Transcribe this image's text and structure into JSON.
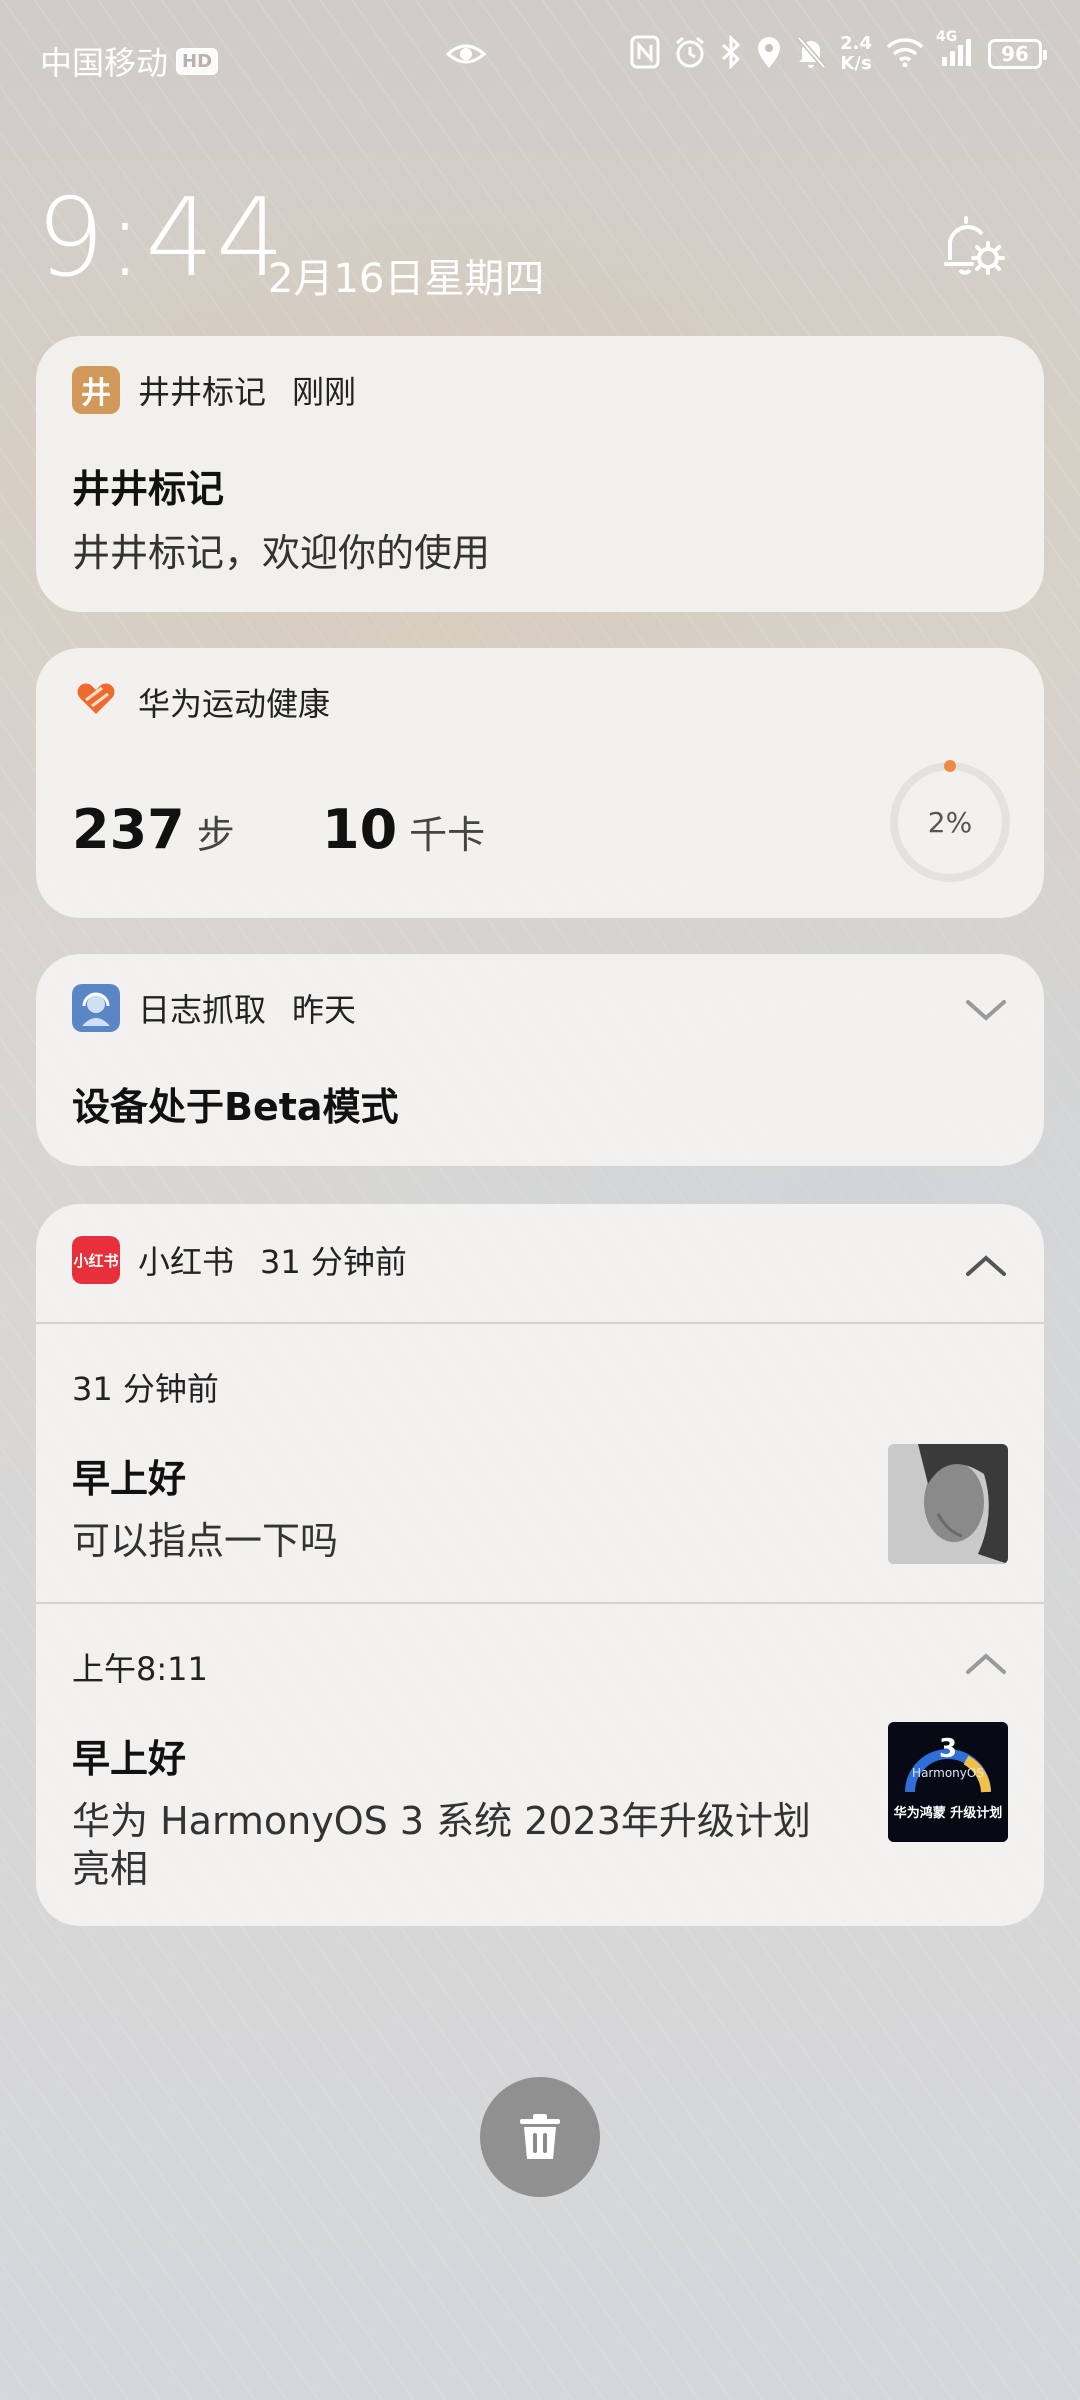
{
  "status_bar": {
    "carrier": "中国移动",
    "hd_badge": "HD",
    "net_speed_value": "2.4",
    "net_speed_unit": "K/s",
    "signal_label": "4G",
    "battery": "96",
    "icons": [
      "eye-icon",
      "nfc-icon",
      "alarm-icon",
      "bluetooth-icon",
      "location-icon",
      "mute-bell-icon",
      "wifi-icon",
      "cellular-signal-icon",
      "battery-icon"
    ]
  },
  "lockscreen": {
    "time": "9:44",
    "date": "2月16日星期四",
    "notification_settings_icon": "bell-settings-icon"
  },
  "notifications": [
    {
      "app_name": "井井标记",
      "app_icon_glyph": "井",
      "app_color": "#d29a5a",
      "time": "刚刚",
      "title": "井井标记",
      "text": "井井标记，欢迎你的使用"
    },
    {
      "app_name": "华为运动健康",
      "app_color": "#ef6a2c",
      "steps_value": "237",
      "steps_unit": "步",
      "calories_value": "10",
      "calories_unit": "千卡",
      "progress_label": "2%",
      "progress_fraction": 0.02
    },
    {
      "app_name": "日志抓取",
      "app_color": "#5a86c5",
      "time": "昨天",
      "title": "设备处于Beta模式"
    },
    {
      "app_name": "小红书",
      "app_icon_text": "小红书",
      "app_color": "#e8303c",
      "time": "31 分钟前",
      "items": [
        {
          "time": "31 分钟前",
          "title": "早上好",
          "text": "可以指点一下吗"
        },
        {
          "time": "上午8:11",
          "title": "早上好",
          "text_line1": "华为 HarmonyOS 3 系统 2023年升级计划",
          "text_line2": "亮相",
          "thumb_number": "3",
          "thumb_brand": "HarmonyOS",
          "thumb_caption": "华为鸿蒙 升级计划"
        }
      ]
    }
  ],
  "clear_all_icon": "trash-icon"
}
